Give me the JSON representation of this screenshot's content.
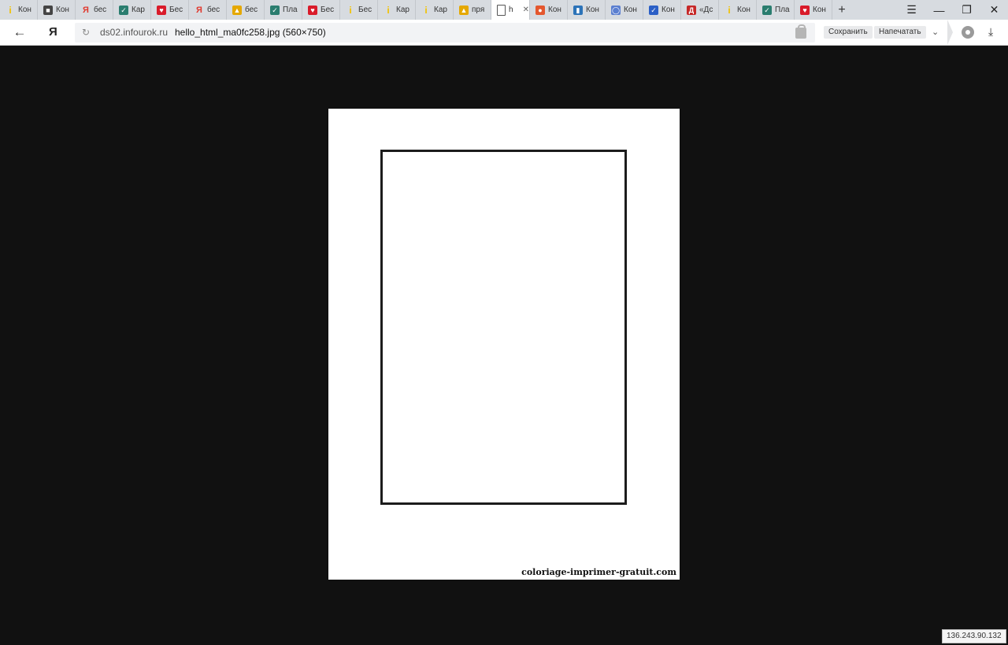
{
  "tabs": [
    {
      "label": "Кон",
      "icon": "yellow-i-icon",
      "color": "#f2c200"
    },
    {
      "label": "Кон",
      "icon": "dark-square-icon",
      "color": "#444444"
    },
    {
      "label": "бес",
      "icon": "yandex-ya-icon",
      "color": "#e03a2f"
    },
    {
      "label": "Кар",
      "icon": "green-check-icon",
      "color": "#2a7d6f"
    },
    {
      "label": "Бес",
      "icon": "red-heart-icon",
      "color": "#d91b2a"
    },
    {
      "label": "бес",
      "icon": "yandex-ya-icon",
      "color": "#e03a2f"
    },
    {
      "label": "бес",
      "icon": "yellow-image-icon",
      "color": "#e5a800"
    },
    {
      "label": "Пла",
      "icon": "green-check-icon",
      "color": "#2a7d6f"
    },
    {
      "label": "Бес",
      "icon": "red-heart-icon",
      "color": "#d91b2a"
    },
    {
      "label": "Бес",
      "icon": "yellow-i-icon",
      "color": "#f2c200"
    },
    {
      "label": "Кар",
      "icon": "yellow-i-icon",
      "color": "#f2c200"
    },
    {
      "label": "Кар",
      "icon": "yellow-i-icon",
      "color": "#f2c200"
    },
    {
      "label": "пря",
      "icon": "yellow-image-icon",
      "color": "#e5a800"
    },
    {
      "label": "h",
      "icon": "page-icon",
      "color": "#ffffff",
      "active": true
    },
    {
      "label": "Кон",
      "icon": "orange-circle-icon",
      "color": "#e4572e"
    },
    {
      "label": "Кон",
      "icon": "blue-book-icon",
      "color": "#2c73b8"
    },
    {
      "label": "Кон",
      "icon": "blue-circle-icon",
      "color": "#5b7fd0"
    },
    {
      "label": "Кон",
      "icon": "blue-check-icon",
      "color": "#2b5fc6"
    },
    {
      "label": "«Дс",
      "icon": "red-d-icon",
      "color": "#c62828"
    },
    {
      "label": "Кон",
      "icon": "yellow-i-icon",
      "color": "#f2c200"
    },
    {
      "label": "Пла",
      "icon": "green-check-icon",
      "color": "#2a7d6f"
    },
    {
      "label": "Кон",
      "icon": "red-heart-icon",
      "color": "#d91b2a"
    }
  ],
  "browser": {
    "logo": "Я",
    "domain": "ds02.infourok.ru",
    "page_title": "hello_html_ma0fc258.jpg (560×750)",
    "save_label": "Сохранить",
    "print_label": "Напечатать"
  },
  "content": {
    "watermark": "coloriage-imprimer-gratuit.com"
  },
  "status": {
    "ip": "136.243.90.132"
  }
}
